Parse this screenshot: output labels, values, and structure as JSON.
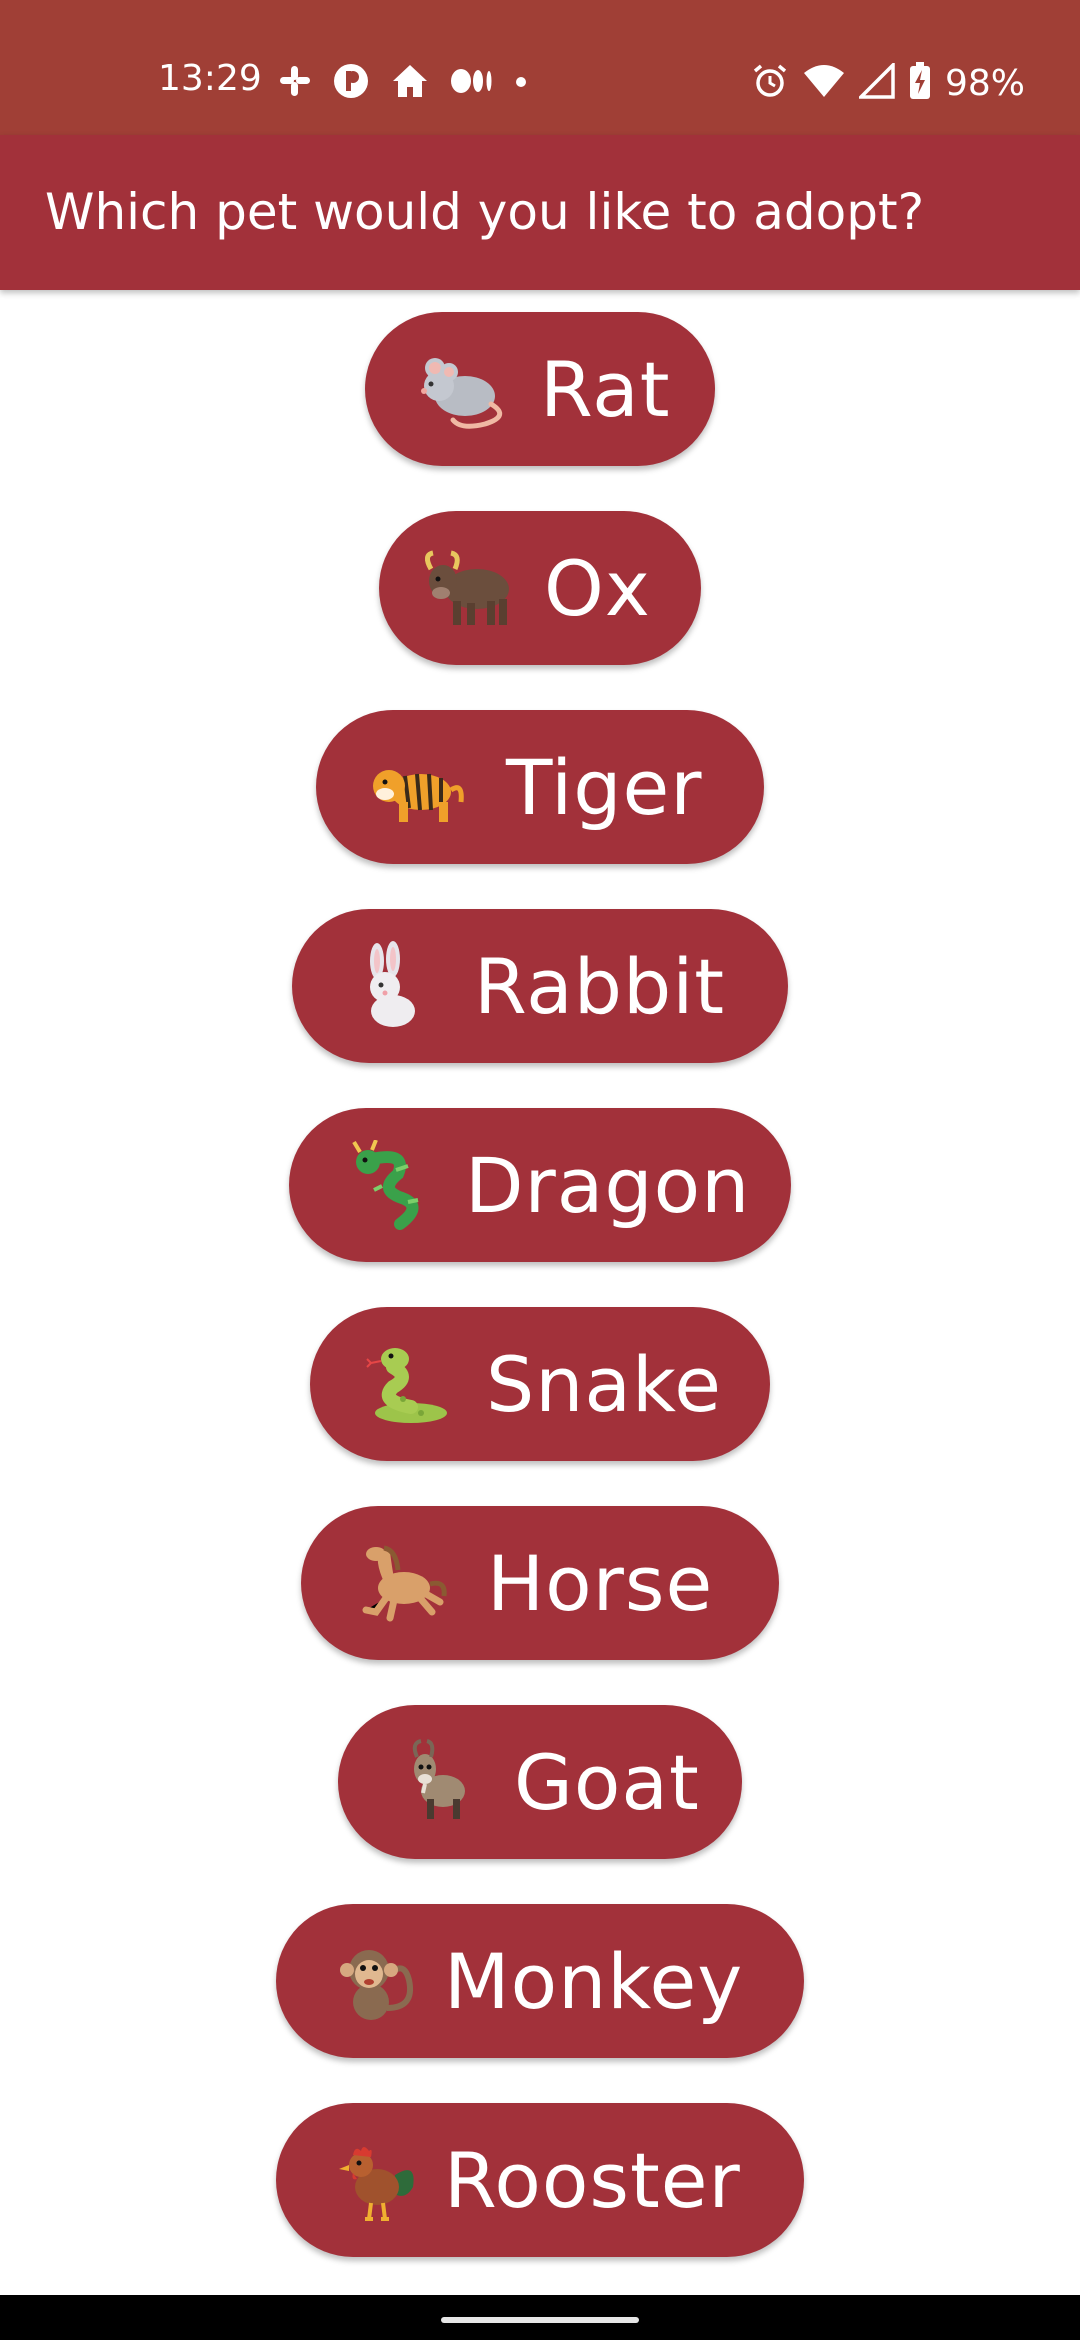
{
  "status_bar": {
    "time": "13:29",
    "battery": "98%",
    "icons_left": [
      "slack-icon",
      "app-p-icon",
      "home-icon",
      "medium-icon",
      "dot-icon"
    ],
    "icons_right": [
      "alarm-icon",
      "wifi-icon",
      "signal-icon",
      "battery-charging-icon"
    ]
  },
  "app_bar": {
    "title": "Which pet would you like to adopt?",
    "background": "#a2313a"
  },
  "pets": [
    {
      "label": "Rat",
      "emoji": "rat-icon"
    },
    {
      "label": "Ox",
      "emoji": "ox-icon"
    },
    {
      "label": "Tiger",
      "emoji": "tiger-icon"
    },
    {
      "label": "Rabbit",
      "emoji": "rabbit-icon"
    },
    {
      "label": "Dragon",
      "emoji": "dragon-icon"
    },
    {
      "label": "Snake",
      "emoji": "snake-icon"
    },
    {
      "label": "Horse",
      "emoji": "horse-icon"
    },
    {
      "label": "Goat",
      "emoji": "goat-icon"
    },
    {
      "label": "Monkey",
      "emoji": "monkey-icon"
    },
    {
      "label": "Rooster",
      "emoji": "rooster-icon"
    }
  ],
  "colors": {
    "status_bar": "#a03f36",
    "button": "#a2313a",
    "text": "#ffffff"
  }
}
